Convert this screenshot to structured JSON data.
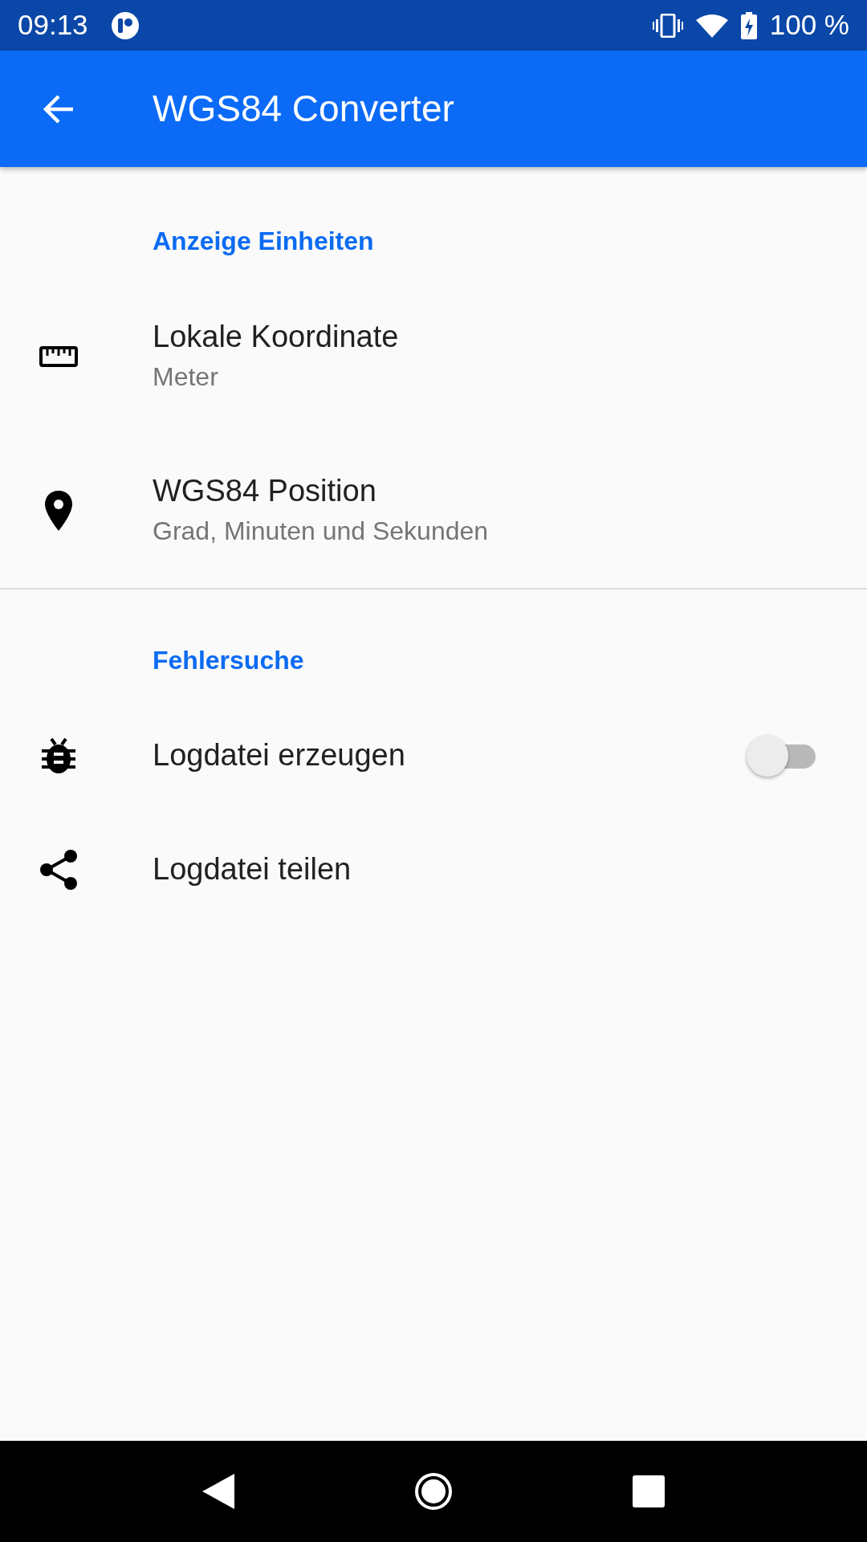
{
  "status_bar": {
    "time": "09:13",
    "battery": "100 %"
  },
  "app_bar": {
    "title": "WGS84 Converter"
  },
  "sections": [
    {
      "header": "Anzeige Einheiten",
      "items": [
        {
          "kind": "plain",
          "title": "Lokale Koordinate",
          "subtitle": "Meter"
        },
        {
          "kind": "plain",
          "title": "WGS84 Position",
          "subtitle": "Grad, Minuten und Sekunden"
        }
      ]
    },
    {
      "header": "Fehlersuche",
      "items": [
        {
          "kind": "switch",
          "title": "Logdatei erzeugen",
          "on": false
        },
        {
          "kind": "plain",
          "title": "Logdatei teilen"
        }
      ]
    }
  ]
}
